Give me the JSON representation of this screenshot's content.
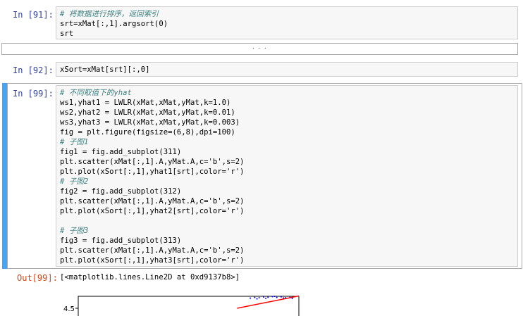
{
  "cells": [
    {
      "prompt": "In  [91]:",
      "comment": "# 将数据进行排序，返回索引",
      "lines": [
        "srt=xMat[:,1].argsort(0)",
        "srt"
      ]
    },
    {
      "collapsed_label": "· · ·"
    },
    {
      "prompt": "In  [92]:",
      "code": "xSort=xMat[srt][:,0]"
    },
    {
      "prompt": "In  [99]:",
      "comment1": "# 不同取值下的yhat",
      "l1": "ws1,yhat1 = LWLR(xMat,xMat,yMat,k=1.0)",
      "l2": "ws2,yhat2 = LWLR(xMat,xMat,yMat,k=0.01)",
      "l3": "ws3,yhat3 = LWLR(xMat,xMat,yMat,k=0.003)",
      "l4": "fig = plt.figure(figsize=(6,8),dpi=100)",
      "c_sub1": "# 子图1",
      "l5": "fig1 = fig.add_subplot(311)",
      "l6": "plt.scatter(xMat[:,1].A,yMat.A,c='b',s=2)",
      "l7": "plt.plot(xSort[:,1],yhat1[srt],color='r')",
      "c_sub2": "# 子图2",
      "l8": "fig2 = fig.add_subplot(312)",
      "l9": "plt.scatter(xMat[:,1].A,yMat.A,c='b',s=2)",
      "l10": "plt.plot(xSort[:,1],yhat2[srt],color='r')",
      "c_sub3": "# 子图3",
      "l11": "fig3 = fig.add_subplot(313)",
      "l12": "plt.scatter(xMat[:,1].A,yMat.A,c='b',s=2)",
      "l13": "plt.plot(xSort[:,1],yhat3[srt],color='r')"
    }
  ],
  "output": {
    "prompt": "Out[99]:",
    "text": "[<matplotlib.lines.Line2D at 0xd9137b8>]"
  },
  "chart_data": {
    "type": "scatter",
    "ytick_labels": [
      "4.5"
    ],
    "ylim": [
      4.5,
      4.62
    ],
    "xlim": [
      0,
      1
    ],
    "series": [
      {
        "kind": "scatter",
        "color": "#0000ff",
        "x": [
          0.78,
          0.8,
          0.82,
          0.84,
          0.86,
          0.88,
          0.9,
          0.92,
          0.94,
          0.96,
          0.81,
          0.85,
          0.89,
          0.93,
          0.97
        ],
        "y": [
          4.586,
          4.592,
          4.59,
          4.596,
          4.594,
          4.599,
          4.592,
          4.597,
          4.589,
          4.593,
          4.58,
          4.585,
          4.601,
          4.588,
          4.584
        ]
      },
      {
        "kind": "line",
        "color": "#ff0000",
        "x": [
          0.72,
          1.0
        ],
        "y": [
          4.5,
          4.605
        ]
      }
    ]
  },
  "colors": {
    "selected_cell_bar": "#42a5f5",
    "prompt_in": "#303f9f",
    "prompt_out": "#d84315"
  }
}
